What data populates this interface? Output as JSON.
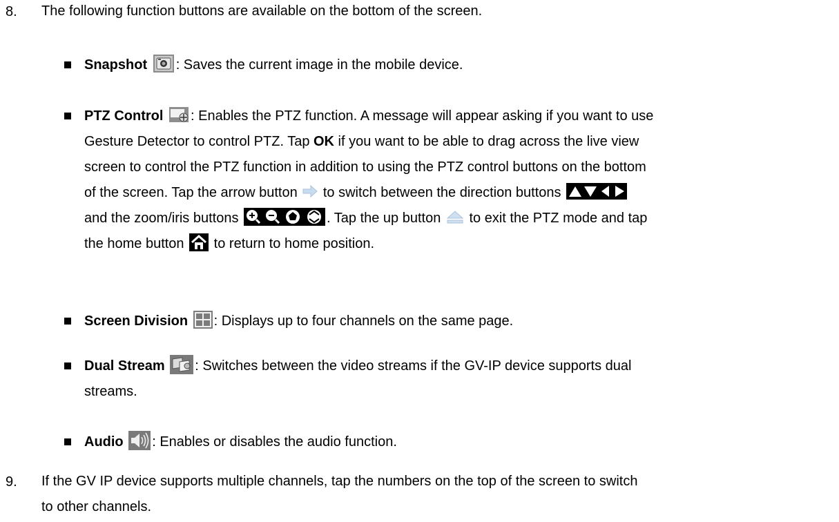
{
  "items": [
    {
      "number": "8.",
      "text": "The following function buttons are available on the bottom of the screen."
    },
    {
      "number": "9.",
      "text1": "If the GV IP device supports multiple channels, tap the numbers on the top of the screen to switch",
      "text2": "to other channels."
    }
  ],
  "bullets": {
    "snapshot": {
      "title": "Snapshot",
      "icon": "camera-icon",
      "desc": ": Saves the current image in the mobile device."
    },
    "ptz": {
      "title": "PTZ Control",
      "icon": "ptz-icon",
      "desc1": ": Enables the PTZ function. A message will appear asking if you want to use",
      "line2a": "Gesture Detector to control PTZ. Tap ",
      "ok": "OK",
      "line2b": " if you want to be able to drag across the live view",
      "line3": "screen to control the PTZ function in addition to using the PTZ control buttons on the bottom",
      "line4a": "of the screen. Tap the arrow button ",
      "line4b": " to switch between the direction buttons",
      "line5a": "and the zoom/iris buttons ",
      "line5b": ". Tap the up button ",
      "line5c": " to exit the PTZ mode and tap",
      "line6a": "the home button ",
      "line6b": " to return to home position."
    },
    "screen_division": {
      "title": "Screen Division",
      "icon": "grid-icon",
      "desc": ": Displays up to four channels on the same page."
    },
    "dual_stream": {
      "title": "Dual Stream",
      "icon": "dual-stream-icon",
      "desc1": ": Switches between the video streams if the GV-IP device supports dual",
      "desc2": "streams."
    },
    "audio": {
      "title": "Audio",
      "icon": "speaker-icon",
      "desc": ": Enables or disables the audio function."
    }
  }
}
